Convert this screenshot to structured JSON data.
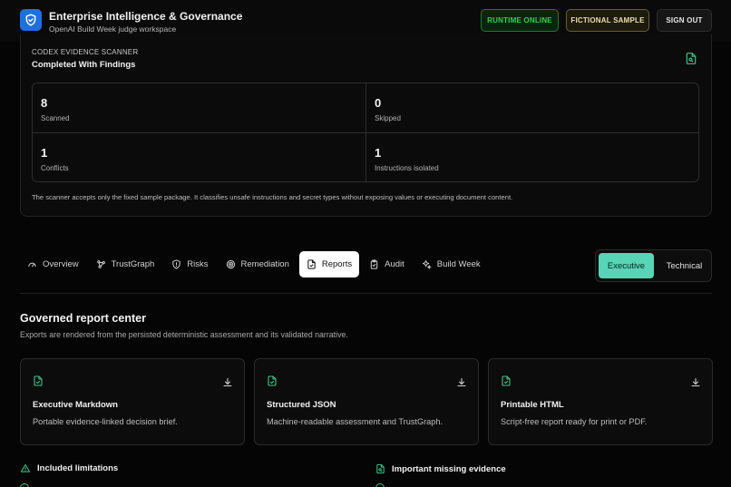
{
  "header": {
    "title": "Enterprise Intelligence & Governance",
    "subtitle": "OpenAI Build Week judge workspace",
    "runtime_label": "RUNTIME ONLINE",
    "fictional_label": "FICTIONAL SAMPLE",
    "signout_label": "SIGN OUT"
  },
  "scanner": {
    "eyebrow": "CODEX EVIDENCE SCANNER",
    "status": "Completed With Findings",
    "stats": [
      {
        "value": "8",
        "label": "Scanned"
      },
      {
        "value": "0",
        "label": "Skipped"
      },
      {
        "value": "1",
        "label": "Conflicts"
      },
      {
        "value": "1",
        "label": "Instructions isolated"
      }
    ],
    "note": "The scanner accepts only the fixed sample package. It classifies unsafe instructions and secret types without exposing values or executing document content."
  },
  "tabs": [
    {
      "label": "Overview",
      "icon": "gauge-icon"
    },
    {
      "label": "TrustGraph",
      "icon": "graph-icon"
    },
    {
      "label": "Risks",
      "icon": "shield-icon"
    },
    {
      "label": "Remediation",
      "icon": "target-icon"
    },
    {
      "label": "Reports",
      "icon": "file-icon",
      "active": true
    },
    {
      "label": "Audit",
      "icon": "clipboard-icon"
    },
    {
      "label": "Build Week",
      "icon": "sparkle-icon"
    }
  ],
  "view_toggle": {
    "executive": "Executive",
    "technical": "Technical",
    "selected": "Executive"
  },
  "report_center": {
    "title": "Governed report center",
    "subtitle": "Exports are rendered from the persisted deterministic assessment and its validated narrative.",
    "cards": [
      {
        "name": "Executive Markdown",
        "description": "Portable evidence-linked decision brief."
      },
      {
        "name": "Structured JSON",
        "description": "Machine-readable assessment and TrustGraph."
      },
      {
        "name": "Printable HTML",
        "description": "Script-free report ready for print or PDF."
      }
    ]
  },
  "limitations": {
    "included": "Included limitations",
    "missing": "Important missing evidence"
  },
  "colors": {
    "accent": "#58d4b6",
    "icon_green": "#3ec48a",
    "runtime": "#33d24e",
    "brand": "#1f6fe0"
  }
}
